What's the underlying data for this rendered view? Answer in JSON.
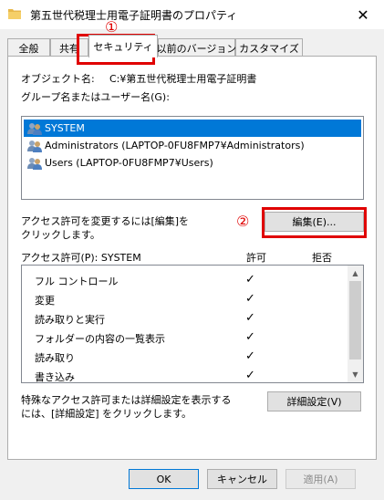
{
  "window": {
    "title": "第五世代税理士用電子証明書のプロパティ",
    "close_glyph": "✕",
    "icon": "folder-icon"
  },
  "tabs": [
    {
      "label": "全般",
      "active": false
    },
    {
      "label": "共有",
      "active": false
    },
    {
      "label": "セキュリティ",
      "active": true
    },
    {
      "label": "以前のバージョン",
      "active": false
    },
    {
      "label": "カスタマイズ",
      "active": false
    }
  ],
  "security": {
    "object_name_label": "オブジェクト名:",
    "object_name_value": "C:¥第五世代税理士用電子証明書",
    "groups_label": "グループ名またはユーザー名(G):",
    "groups": [
      {
        "name": "SYSTEM",
        "selected": true,
        "icon": "user-group-icon"
      },
      {
        "name": "Administrators (LAPTOP-0FU8FMP7¥Administrators)",
        "selected": false,
        "icon": "user-group-icon"
      },
      {
        "name": "Users (LAPTOP-0FU8FMP7¥Users)",
        "selected": false,
        "icon": "user-group-icon"
      }
    ],
    "edit_hint_line1": "アクセス許可を変更するには[編集]を",
    "edit_hint_line2": "クリックします。",
    "edit_button": "編集(E)...",
    "permissions_label": "アクセス許可(P): SYSTEM",
    "allow_header": "許可",
    "deny_header": "拒否",
    "permissions": [
      {
        "name": "フル コントロール",
        "allow": true,
        "deny": false
      },
      {
        "name": "変更",
        "allow": true,
        "deny": false
      },
      {
        "name": "読み取りと実行",
        "allow": true,
        "deny": false
      },
      {
        "name": "フォルダーの内容の一覧表示",
        "allow": true,
        "deny": false
      },
      {
        "name": "読み取り",
        "allow": true,
        "deny": false
      },
      {
        "name": "書き込み",
        "allow": true,
        "deny": false
      }
    ],
    "check_glyph": "✓",
    "advanced_hint_line1": "特殊なアクセス許可または詳細設定を表示する",
    "advanced_hint_line2": "には、[詳細設定] をクリックします。",
    "advanced_button": "詳細設定(V)"
  },
  "footer": {
    "ok": "OK",
    "cancel": "キャンセル",
    "apply": "適用(A)"
  },
  "annotations": {
    "marker1": "①",
    "marker2": "②",
    "color": "#e00000"
  }
}
